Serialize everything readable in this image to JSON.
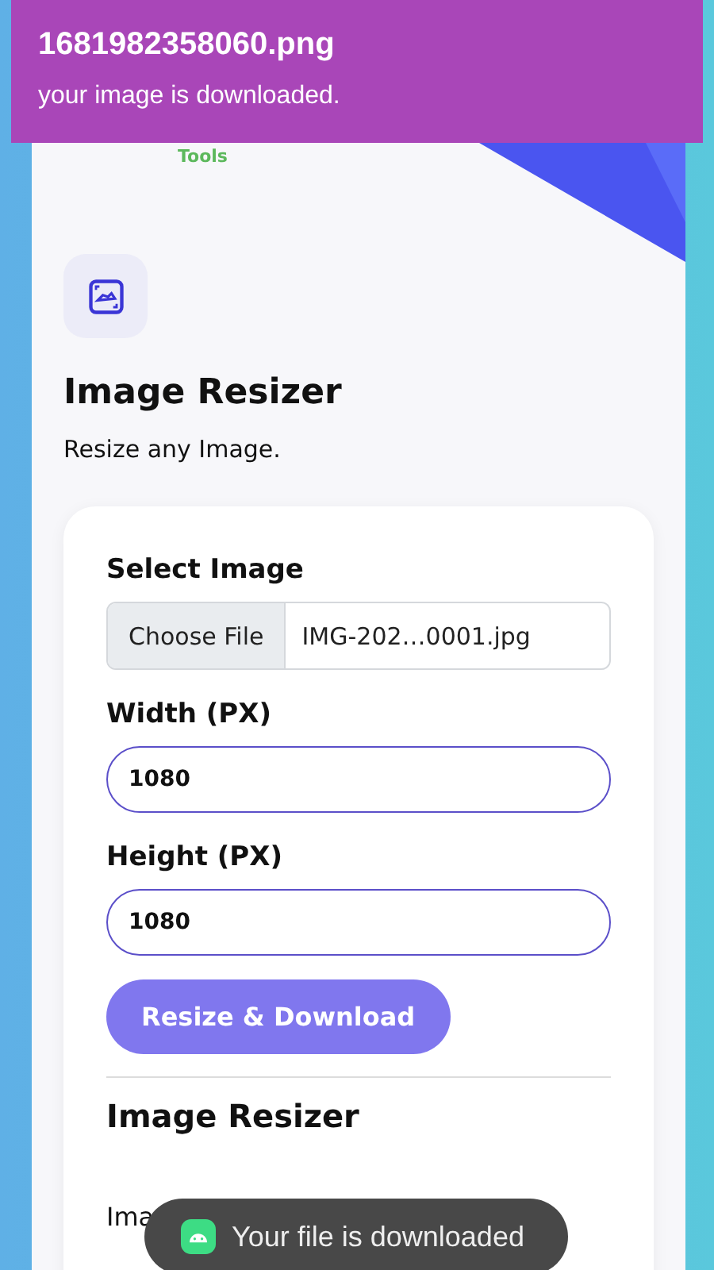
{
  "notification": {
    "title": "1681982358060.png",
    "message": "your image is downloaded."
  },
  "logo": {
    "text": "Tools"
  },
  "tool": {
    "title": "Image Resizer",
    "subtitle": "Resize any Image."
  },
  "form": {
    "file_label": "Select Image",
    "file_button": "Choose File",
    "file_name": "IMG-202…0001.jpg",
    "fields": [
      {
        "label": "Width (PX)",
        "value": "1080"
      },
      {
        "label": "Height (PX)",
        "value": "1080"
      }
    ],
    "submit": "Resize & Download"
  },
  "about": {
    "heading": "Image Resizer",
    "text": "Ima"
  },
  "toast": {
    "message": "Your file is downloaded"
  }
}
